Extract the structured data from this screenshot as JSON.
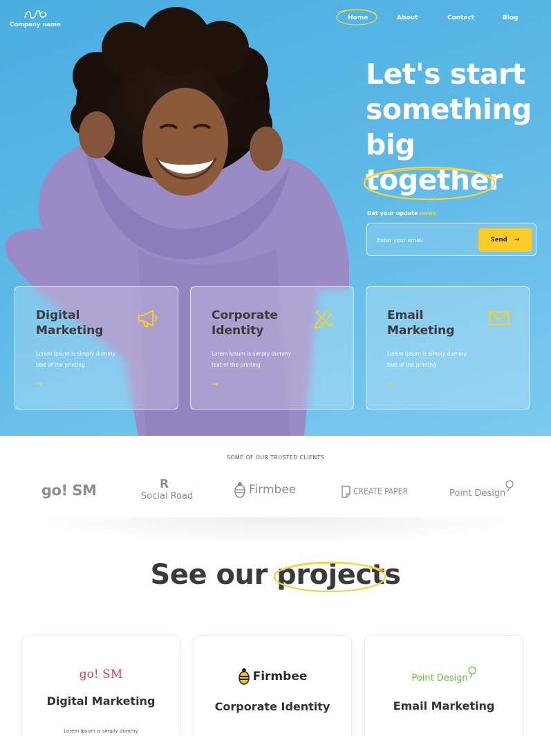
{
  "header": {
    "company_name": "Company name",
    "nav": [
      "Home",
      "About",
      "Contact",
      "Blog"
    ],
    "active_nav": "Home"
  },
  "hero": {
    "headline_lines": [
      "Let's start",
      "something",
      "big",
      "together"
    ],
    "subtitle_prefix": "Get your update ",
    "subtitle_highlight": "news",
    "email_placeholder": "Enter your email",
    "send_label": "Send",
    "send_arrow": "→"
  },
  "services": [
    {
      "title": "Digital Marketing",
      "text": "Lorem Ipsum is simply dummy text of the printing",
      "icon": "megaphone-icon"
    },
    {
      "title": "Corporate Identity",
      "text": "Lorem Ipsum is simply dummy text of the printing",
      "icon": "pencil-ruler-icon"
    },
    {
      "title": "Email Marketing",
      "text": "Lorem Ipsum is simply dummy text of the printing",
      "icon": "envelope-icon"
    }
  ],
  "service_arrow": "→",
  "clients": {
    "title": "SOME OF OUR TRUSTED CLIENTS",
    "logos": [
      "go! SM",
      "R",
      "Social Road",
      "Firmbee",
      "CREATE PAPER",
      "Point Design"
    ]
  },
  "projects": {
    "title": "See our projects",
    "items": [
      {
        "logo": "go! SM",
        "name": "Digital Marketing",
        "text": "Lorem Ipsum is simply dummy"
      },
      {
        "logo": "Firmbee",
        "name": "Corporate Identity",
        "text": ""
      },
      {
        "logo": "Point Design",
        "name": "Email Marketing",
        "text": ""
      }
    ]
  },
  "colors": {
    "hero_blue": "#4aaee0",
    "accent_yellow": "#fbcb27",
    "dark_text": "#3a3a3a",
    "hoodie_purple": "#9a8cc8"
  }
}
